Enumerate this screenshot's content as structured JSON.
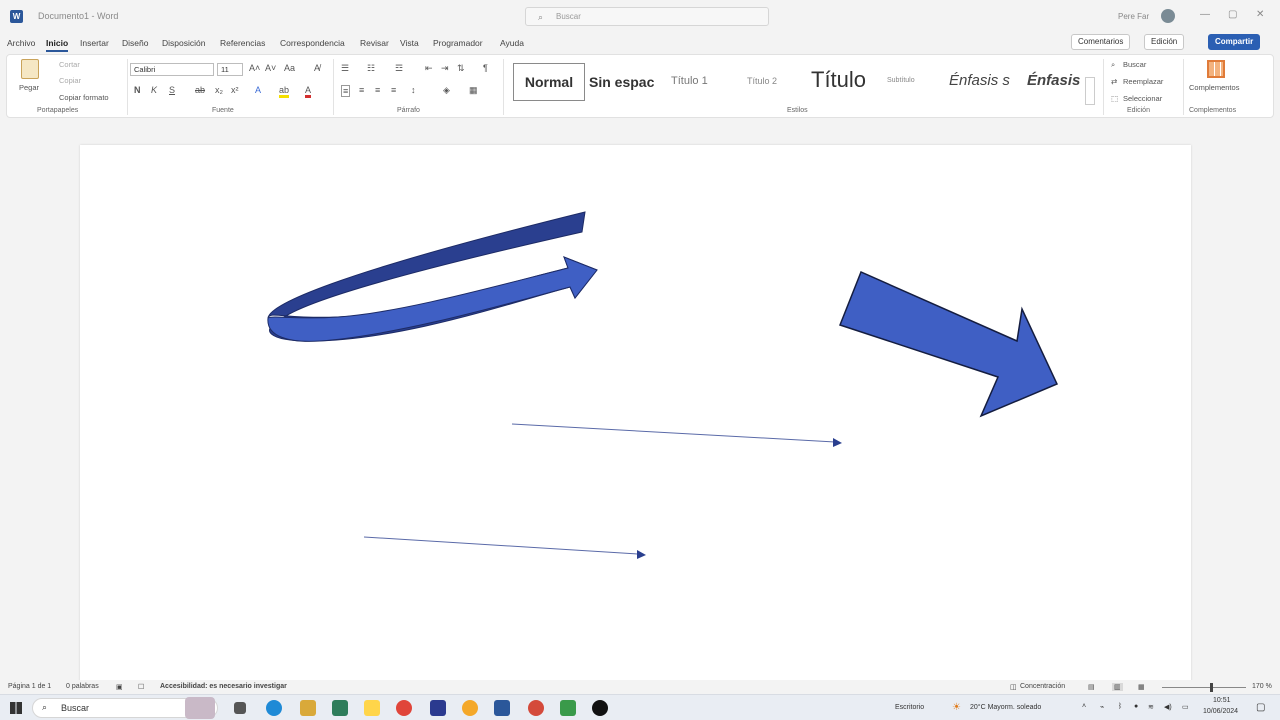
{
  "window": {
    "doc_title": "Documento1 - Word",
    "search_placeholder": "Buscar",
    "user_name": "Pere Far"
  },
  "menu": {
    "tabs": [
      "Archivo",
      "Inicio",
      "Insertar",
      "Diseño",
      "Disposición",
      "Referencias",
      "Correspondencia",
      "Revisar",
      "Vista",
      "Programador",
      "Ayuda"
    ],
    "active": "Inicio",
    "comments_label": "Comentarios",
    "editing_label": "Edición",
    "share_label": "Compartir"
  },
  "ribbon": {
    "clipboard": {
      "paste": "Pegar",
      "cut": "Cortar",
      "copy": "Copiar",
      "format_painter": "Copiar formato",
      "label": "Portapapeles"
    },
    "font": {
      "name": "Calibri",
      "size": "11",
      "label": "Fuente"
    },
    "paragraph": {
      "label": "Párrafo"
    },
    "styles": {
      "items": [
        "Normal",
        "Sin espac",
        "Título 1",
        "Título 2",
        "Título",
        "Subtítulo",
        "Énfasis s",
        "Énfasis"
      ],
      "label": "Estilos"
    },
    "editing": {
      "find": "Buscar",
      "replace": "Reemplazar",
      "select": "Seleccionar",
      "label": "Edición"
    },
    "addins": {
      "label_button": "Complementos",
      "label": "Complementos"
    }
  },
  "status": {
    "page": "Página 1 de 1",
    "words": "0 palabras",
    "accessibility": "Accesibilidad: es necesario investigar",
    "focus": "Concentración",
    "zoom": "170 %"
  },
  "taskbar": {
    "search_label": "Buscar",
    "desktop_label": "Escritorio",
    "weather": "20°C  Mayorm. soleado",
    "time": "10:51",
    "date": "10/06/2024"
  },
  "colors": {
    "word_blue": "#2b579a",
    "shape_fill": "#3f5fc4",
    "shape_dark": "#2a3f8f"
  }
}
